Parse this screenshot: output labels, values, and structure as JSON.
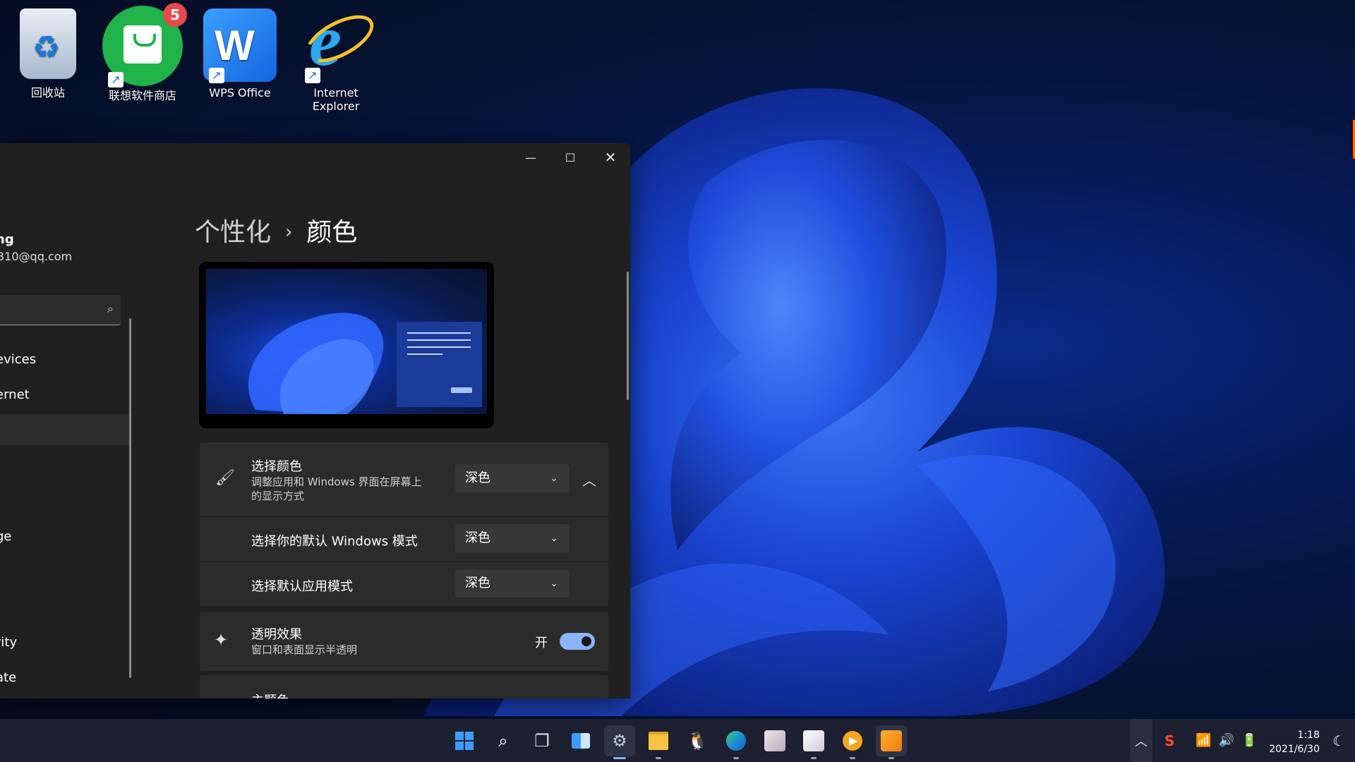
{
  "desktop": {
    "icons": [
      {
        "label": "回收站",
        "icon": "recycle-bin-icon"
      },
      {
        "label": "联想软件商店",
        "icon": "lenovo-store-icon",
        "badge": "5"
      },
      {
        "label": "WPS Office",
        "icon": "wps-office-icon"
      },
      {
        "label": "Internet\nExplorer",
        "label_line1": "Internet",
        "label_line2": "Explorer",
        "icon": "internet-explorer-icon"
      }
    ]
  },
  "settings": {
    "user": {
      "name": "ng",
      "email": "310@qq.com"
    },
    "search_icon": "search-icon",
    "nav": [
      {
        "label": "evices"
      },
      {
        "label": "ernet"
      },
      {
        "label": ""
      },
      {
        "label": "ge"
      },
      {
        "label": "rity"
      },
      {
        "label": "ate"
      }
    ],
    "breadcrumb": {
      "parent": "个性化",
      "separator": "›",
      "current": "颜色"
    },
    "choose_color": {
      "title": "选择颜色",
      "subtitle_line1": "调整应用和 Windows 界面在屏幕上",
      "subtitle_line2": "的显示方式",
      "value": "深色"
    },
    "windows_mode": {
      "title": "选择你的默认 Windows 模式",
      "value": "深色"
    },
    "app_mode": {
      "title": "选择默认应用模式",
      "value": "深色"
    },
    "transparency": {
      "title": "透明效果",
      "subtitle": "窗口和表面显示半透明",
      "state_label": "开",
      "on": true
    },
    "accent": {
      "title": "主题色"
    }
  },
  "taskbar": {
    "apps": [
      "start-icon",
      "search-icon",
      "task-view-icon",
      "widgets-icon",
      "settings-icon",
      "file-explorer-icon",
      "qq-icon",
      "edge-icon",
      "app-icon-1",
      "app-icon-2",
      "video-icon",
      "app-icon-3"
    ],
    "clock": {
      "time": "1:18",
      "date": "2021/6/30"
    }
  },
  "colors": {
    "accent": "#8ab4f8",
    "window_bg": "#202020",
    "card_bg": "#2b2b2b"
  }
}
